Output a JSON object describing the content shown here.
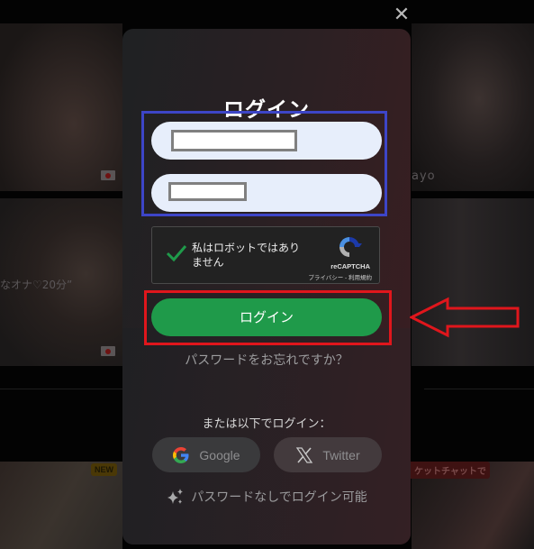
{
  "background": {
    "tiles": [
      {
        "id": "tile-1",
        "flag": "japan"
      },
      {
        "id": "tile-2",
        "flag": "japan",
        "caption": "なオナ♡20分”"
      },
      {
        "id": "tile-3",
        "caption": "ayo"
      },
      {
        "id": "tile-4"
      },
      {
        "id": "tile-5",
        "badge": "NEW"
      },
      {
        "id": "tile-6",
        "badge": "ケットチャットで"
      }
    ]
  },
  "modal": {
    "close_icon": "close-icon",
    "title": "ログイン",
    "username_field": {
      "value": "",
      "redacted": true
    },
    "password_field": {
      "value": "",
      "redacted": true
    },
    "captcha": {
      "label": "私はロボットではありません",
      "checked": true,
      "brand": "reCAPTCHA",
      "links": "プライバシー - 利用規約"
    },
    "login_button": "ログイン",
    "forgot_password": "パスワードをお忘れですか？",
    "alt_login_label": "または以下でログイン：",
    "social_buttons": [
      {
        "label": "Google",
        "icon": "google-icon"
      },
      {
        "label": "Twitter",
        "icon": "x-icon"
      }
    ],
    "passwordless": {
      "icon": "sparkle-icon",
      "label": "パスワードなしでログイン可能"
    }
  },
  "annotations": {
    "highlight_fields_color": "#3d45c7",
    "highlight_login_color": "#e0161c",
    "arrow_color": "#e0161c"
  },
  "colors": {
    "login_button": "#1f9a4a",
    "field_bg": "#e7eefb",
    "captcha_check": "#1f9a4a"
  }
}
